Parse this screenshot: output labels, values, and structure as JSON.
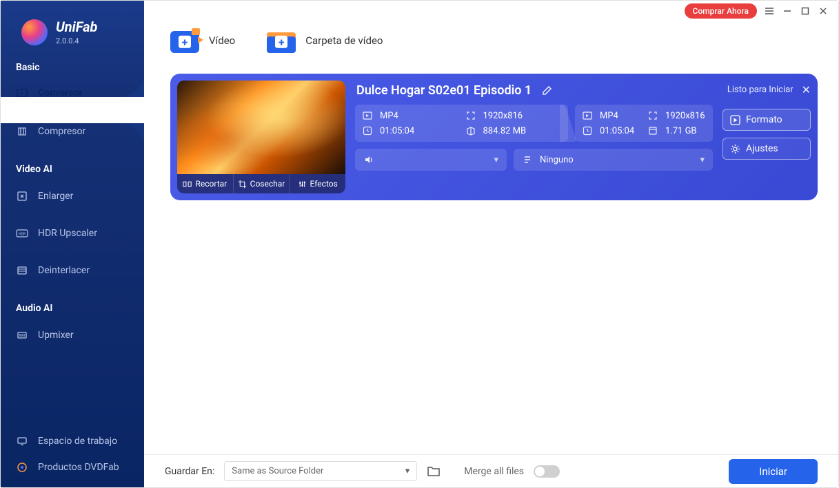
{
  "app": {
    "name": "UniFab",
    "version": "2.0.0.4"
  },
  "titlebar": {
    "buy": "Comprar Ahora"
  },
  "sidebar": {
    "sections": {
      "basic": "Basic",
      "videoai": "Video AI",
      "audioai": "Audio AI"
    },
    "items": {
      "conversor": "Conversor",
      "compresor": "Compresor",
      "enlarger": "Enlarger",
      "hdr": "HDR Upscaler",
      "deinterlacer": "Deinterlacer",
      "upmixer": "Upmixer",
      "workspace": "Espacio de trabajo",
      "dvdfab": "Productos DVDFab"
    }
  },
  "add": {
    "video": "Vídeo",
    "folder": "Carpeta de vídeo"
  },
  "task": {
    "title": "Dulce Hogar S02e01 Episodio 1",
    "status": "Listo para Iniciar",
    "in": {
      "format": "MP4",
      "res": "1920x816",
      "dur": "01:05:04",
      "size": "884.82 MB"
    },
    "out": {
      "format": "MP4",
      "res": "1920x816",
      "dur": "01:05:04",
      "size": "1.71 GB"
    },
    "subtitle_label": "Ninguno",
    "tools": {
      "trim": "Recortar",
      "crop": "Cosechar",
      "fx": "Efectos"
    },
    "buttons": {
      "format": "Formato",
      "settings": "Ajustes"
    }
  },
  "bottom": {
    "save_label": "Guardar En:",
    "save_value": "Same as Source Folder",
    "merge": "Merge all files",
    "start": "Iniciar"
  }
}
